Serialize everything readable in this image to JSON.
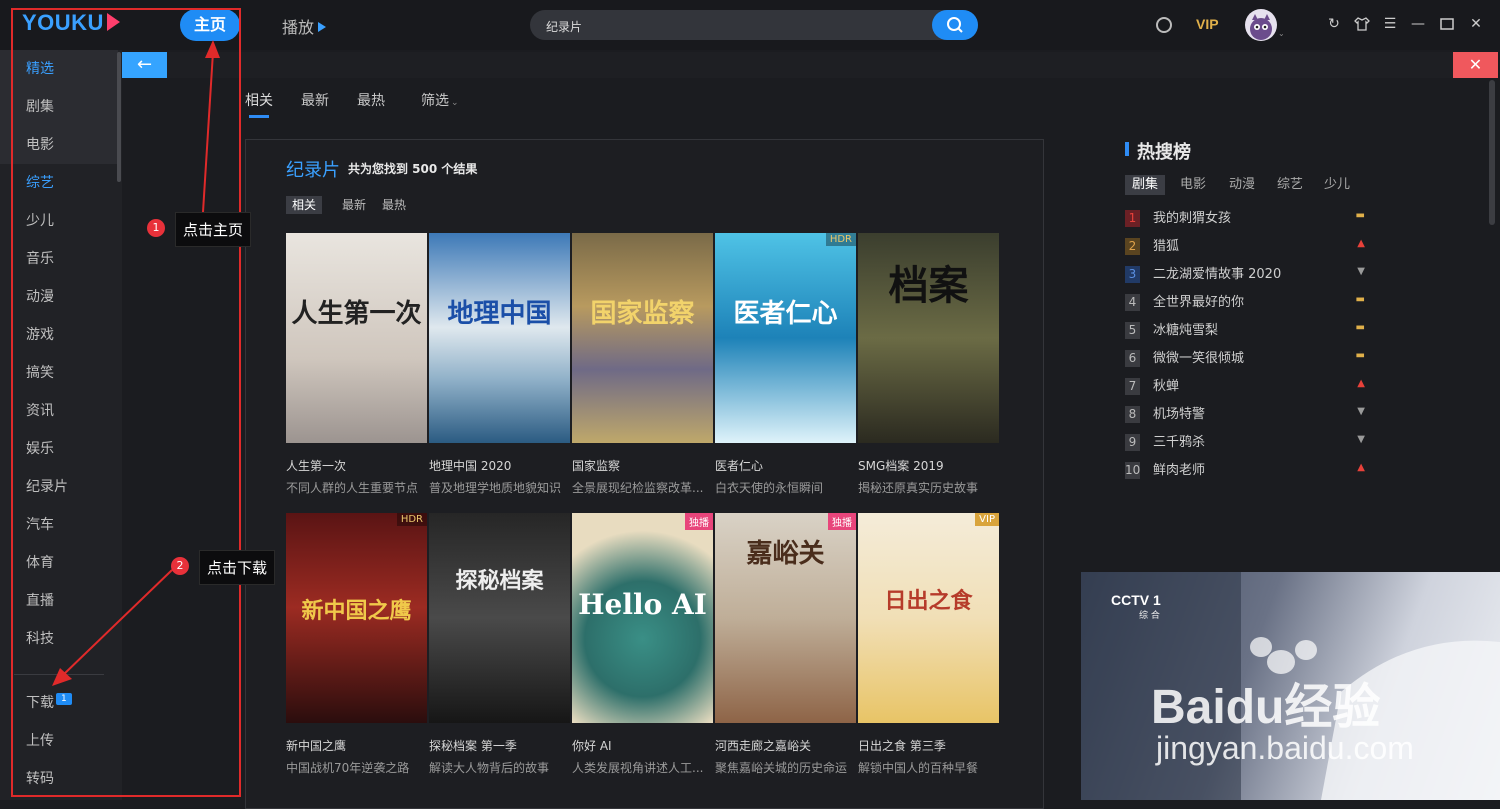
{
  "topbar": {
    "logo": "YOUKU",
    "home_label": "主页",
    "play_label": "播放",
    "search_value": "纪录片",
    "vip_label": "VIP"
  },
  "sidebar": {
    "items": [
      "精选",
      "剧集",
      "电影",
      "综艺",
      "少儿",
      "音乐",
      "动漫",
      "游戏",
      "搞笑",
      "资讯",
      "娱乐",
      "纪录片",
      "汽车",
      "体育",
      "直播",
      "科技"
    ],
    "bottom_items": [
      "下载",
      "上传",
      "转码"
    ],
    "download_badge": "1"
  },
  "main": {
    "tabs": [
      "相关",
      "最新",
      "最热",
      "筛选"
    ],
    "result_title": "纪录片",
    "result_count": "共为您找到 500 个结果",
    "subtabs": [
      "相关",
      "最新",
      "最热"
    ],
    "cards": [
      {
        "title": "人生第一次",
        "desc": "不同人群的人生重要节点",
        "poster_text": "人生第一次",
        "tag": ""
      },
      {
        "title": "地理中国 2020",
        "desc": "普及地理学地质地貌知识",
        "poster_text": "地理中国",
        "tag": ""
      },
      {
        "title": "国家监察",
        "desc": "全景展现纪检监察改革...",
        "poster_text": "国家监察",
        "tag": ""
      },
      {
        "title": "医者仁心",
        "desc": "白衣天使的永恒瞬间",
        "poster_text": "医者仁心",
        "tag": "HDR"
      },
      {
        "title": "SMG档案 2019",
        "desc": "揭秘还原真实历史故事",
        "poster_text": "档案",
        "tag": ""
      },
      {
        "title": "新中国之鹰",
        "desc": "中国战机70年逆袭之路",
        "poster_text": "新中国之鹰",
        "tag": "HDR"
      },
      {
        "title": "探秘档案 第一季",
        "desc": "解读大人物背后的故事",
        "poster_text": "探秘档案",
        "tag": ""
      },
      {
        "title": "你好 AI",
        "desc": "人类发展视角讲述人工...",
        "poster_text": "Hello AI",
        "tag": "独播"
      },
      {
        "title": "河西走廊之嘉峪关",
        "desc": "聚焦嘉峪关城的历史命运",
        "poster_text": "嘉峪关",
        "tag": "独播"
      },
      {
        "title": "日出之食 第三季",
        "desc": "解锁中国人的百种早餐",
        "poster_text": "日出之食",
        "tag": "VIP"
      }
    ]
  },
  "hot": {
    "title": "热搜榜",
    "tabs": [
      "剧集",
      "电影",
      "动漫",
      "综艺",
      "少儿"
    ],
    "items": [
      {
        "rank": "1",
        "name": "我的刺猬女孩",
        "trend": "flat"
      },
      {
        "rank": "2",
        "name": "猎狐",
        "trend": "up"
      },
      {
        "rank": "3",
        "name": "二龙湖爱情故事 2020",
        "trend": "down"
      },
      {
        "rank": "4",
        "name": "全世界最好的你",
        "trend": "flat"
      },
      {
        "rank": "5",
        "name": "冰糖炖雪梨",
        "trend": "flat"
      },
      {
        "rank": "6",
        "name": "微微一笑很倾城",
        "trend": "flat"
      },
      {
        "rank": "7",
        "name": "秋蝉",
        "trend": "up"
      },
      {
        "rank": "8",
        "name": "机场特警",
        "trend": "down"
      },
      {
        "rank": "9",
        "name": "三千鸦杀",
        "trend": "down"
      },
      {
        "rank": "10",
        "name": "鲜肉老师",
        "trend": "up"
      }
    ]
  },
  "video": {
    "channel": "CCTV 1",
    "channel_sub": "综 合",
    "watermark": "Baidu经验",
    "watermark_url": "jingyan.baidu.com"
  },
  "annotations": {
    "step1_num": "1",
    "step1_text": "点击主页",
    "step2_num": "2",
    "step2_text": "点击下载"
  },
  "colors": {
    "accent": "#1f8cf5",
    "annotation_red": "#e02a2a",
    "vip_gold": "#e0b04a",
    "close_red": "#f0585d"
  }
}
